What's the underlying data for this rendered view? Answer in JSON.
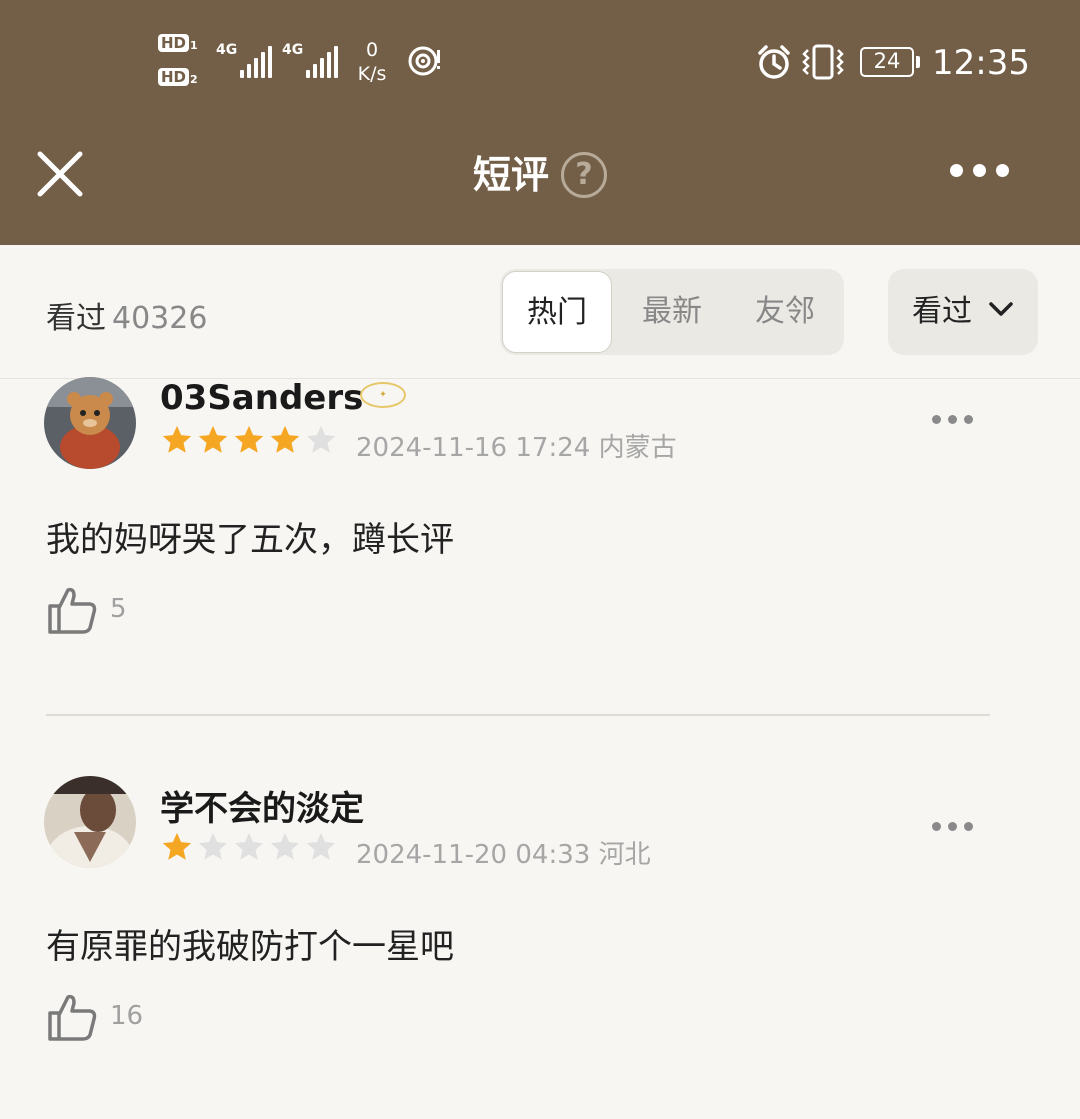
{
  "status_bar": {
    "sim1_label": "HD",
    "sim1_num": "1",
    "sim2_label": "HD",
    "sim2_num": "2",
    "net1_label": "4G",
    "net2_label": "4G",
    "net_speed_value": "0",
    "net_speed_unit": "K/s",
    "battery": "24",
    "time": "12:35",
    "icons": [
      "hotspot-icon",
      "alarm-icon",
      "vibrate-icon",
      "battery-icon"
    ]
  },
  "header": {
    "title": "短评",
    "help_label": "?",
    "close_icon": "close-icon",
    "more_icon": "more-icon"
  },
  "filter": {
    "seen_label": "看过",
    "seen_count": "40326",
    "tabs": [
      {
        "label": "热门",
        "active": true
      },
      {
        "label": "最新",
        "active": false
      },
      {
        "label": "友邻",
        "active": false
      }
    ],
    "dropdown_label": "看过"
  },
  "reviews": [
    {
      "username": "03Sanders",
      "rating": 4,
      "max_rating": 5,
      "date": "2024-11-16 17:24",
      "location": "内蒙古",
      "content": "我的妈呀哭了五次，蹲长评",
      "likes": "5"
    },
    {
      "username": "学不会的淡定",
      "rating": 1,
      "max_rating": 5,
      "date": "2024-11-20 04:33",
      "location": "河北",
      "content": "有原罪的我破防打个一星吧",
      "likes": "16"
    }
  ],
  "colors": {
    "header_bg": "#735f47",
    "page_bg": "#f7f6f2",
    "star_on": "#f5a623",
    "star_off": "#e0e0e0",
    "meta_text": "#a6a6a6"
  }
}
